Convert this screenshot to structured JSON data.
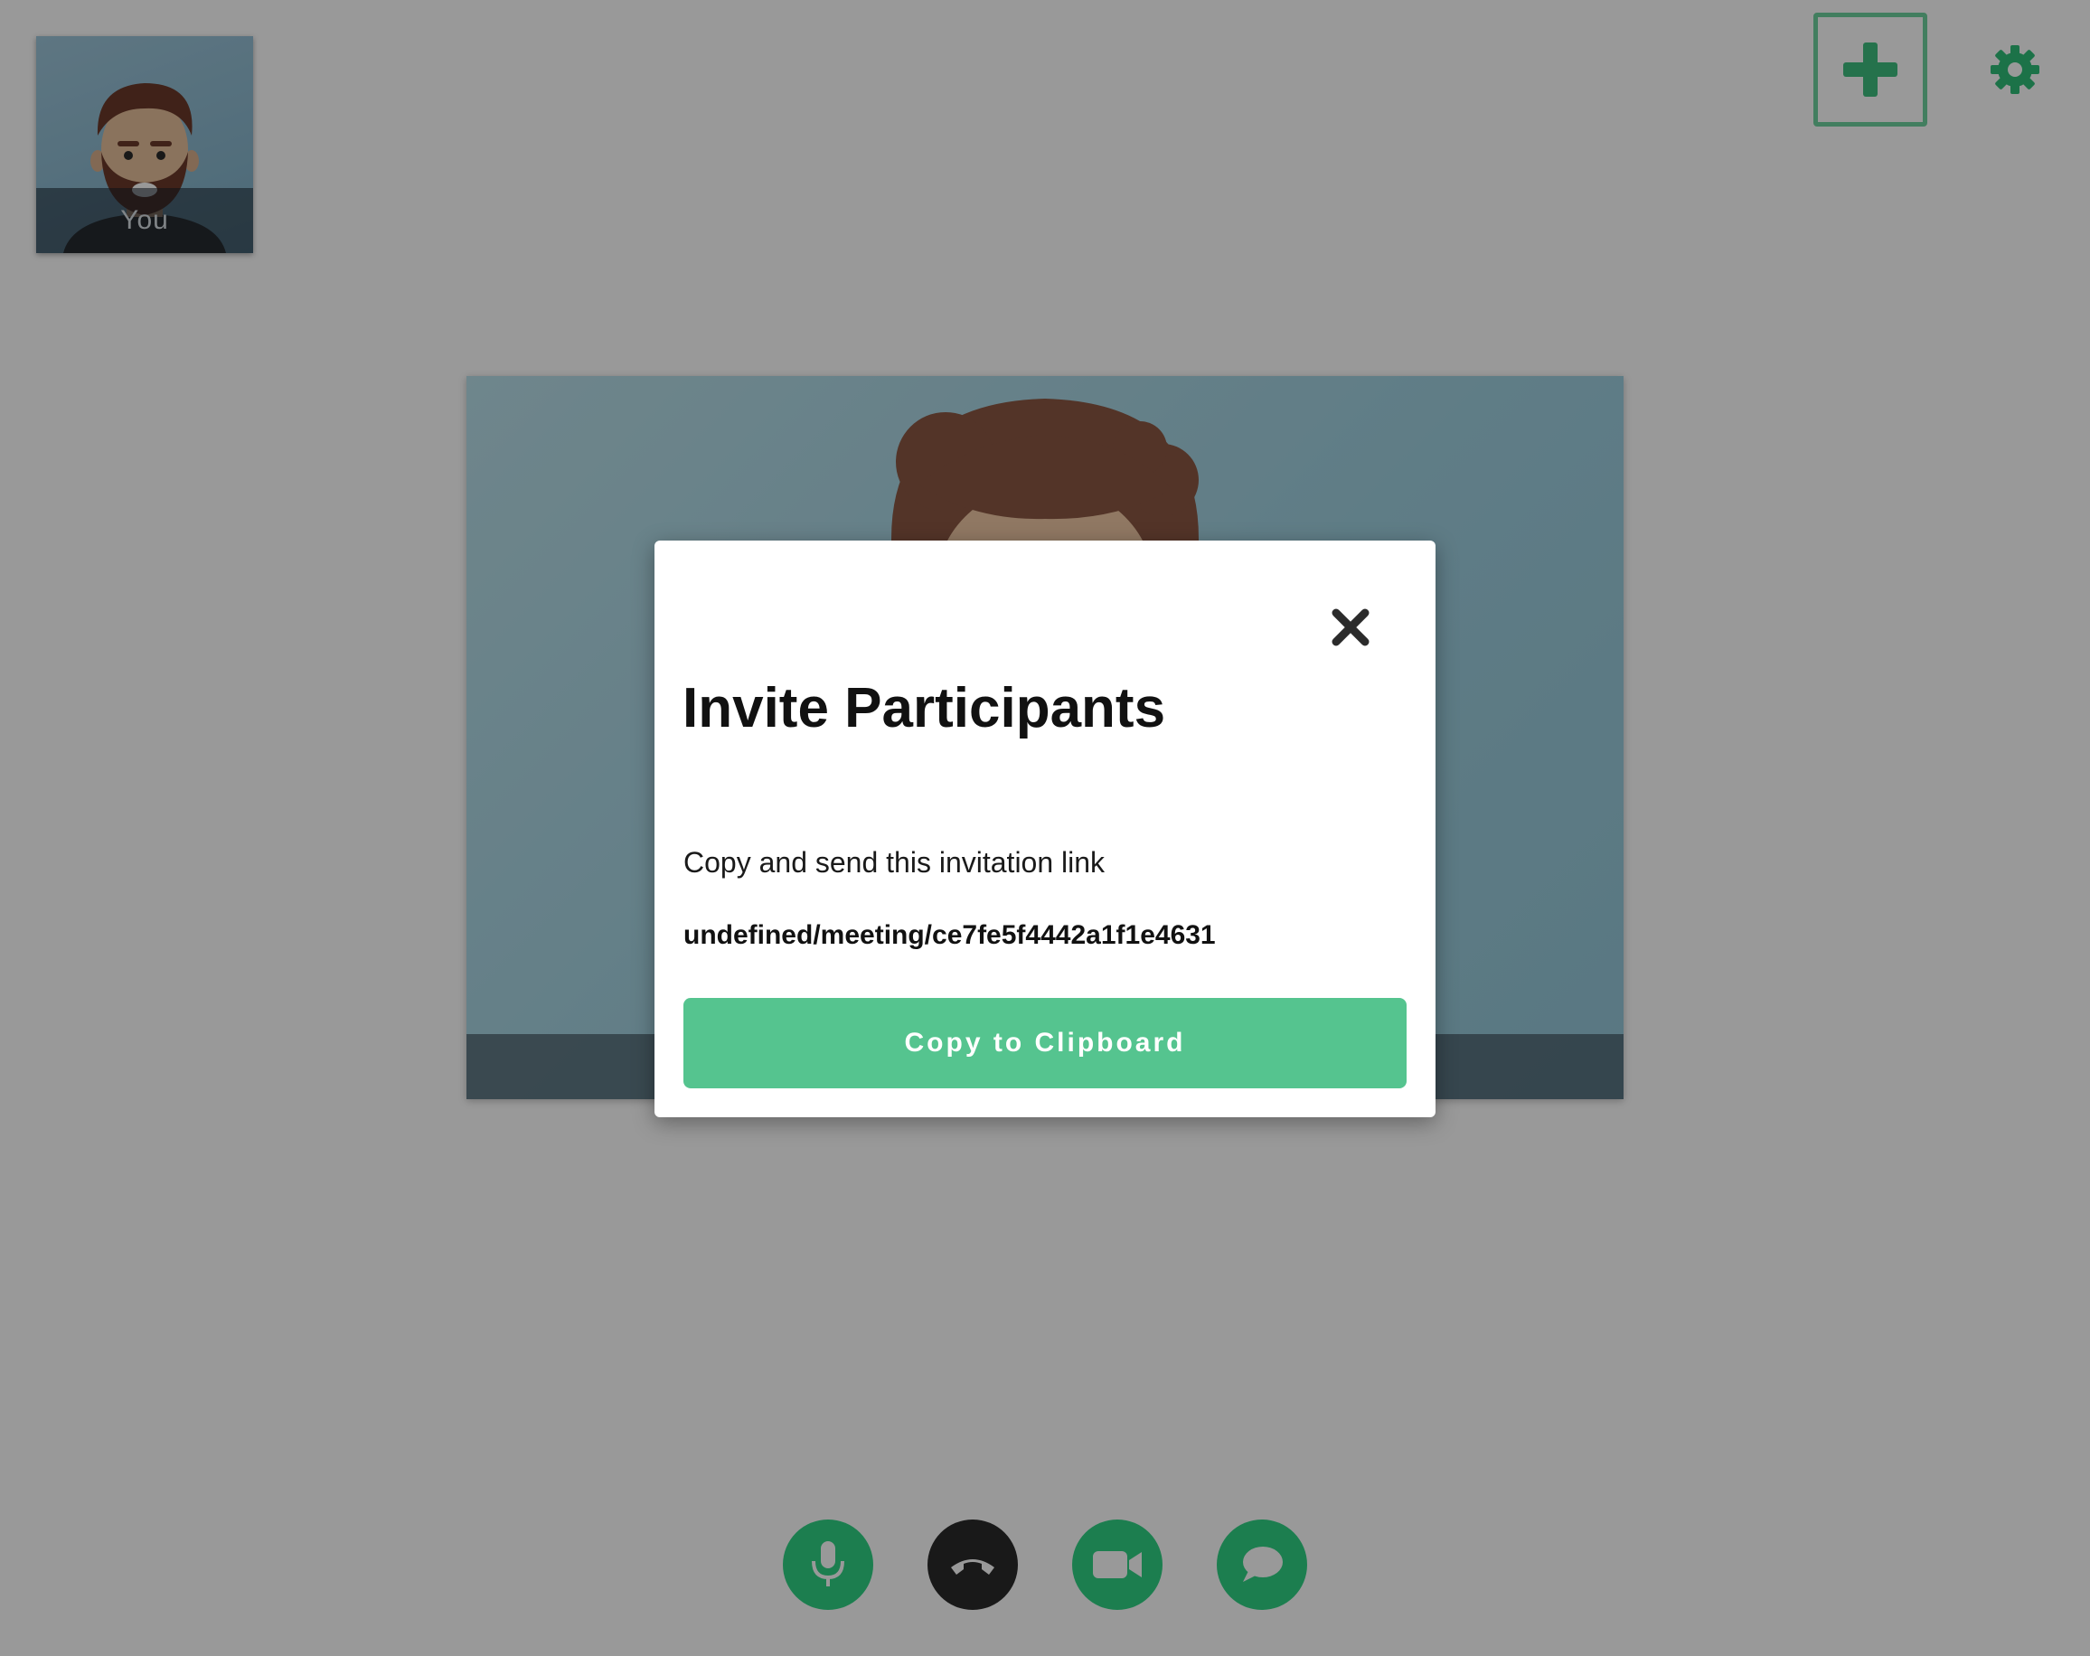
{
  "self_view": {
    "label": "You"
  },
  "top_controls": {
    "invite_icon": "plus-icon",
    "settings_icon": "gear-icon",
    "invite_highlighted": true
  },
  "call_controls": [
    {
      "name": "microphone",
      "icon": "microphone-icon",
      "color": "#2fd384"
    },
    {
      "name": "hang-up",
      "icon": "phone-hangup-icon",
      "color": "#2b2b2b"
    },
    {
      "name": "camera",
      "icon": "video-camera-icon",
      "color": "#2fd384"
    },
    {
      "name": "chat",
      "icon": "chat-bubble-icon",
      "color": "#2fd384"
    }
  ],
  "modal": {
    "title": "Invite Participants",
    "description": "Copy and send this invitation link",
    "link": "undefined/meeting/ce7fe5f4442a1f1e4631",
    "copy_button_label": "Copy to Clipboard",
    "close_icon": "close-icon"
  },
  "colors": {
    "accent_green": "#55c48f",
    "button_green": "#2fd384",
    "overlay": "rgba(0,0,0,0.40)"
  }
}
